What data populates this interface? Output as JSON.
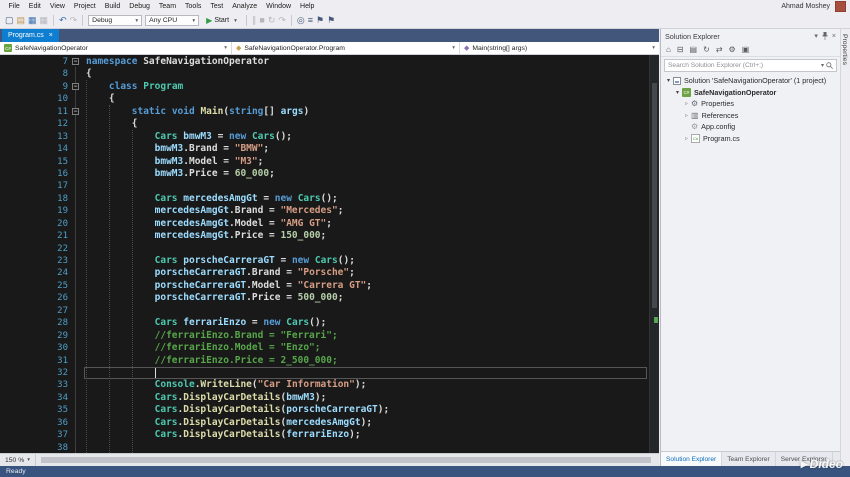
{
  "window": {
    "user": "Ahmad Moshey"
  },
  "menu": {
    "items": [
      "File",
      "Edit",
      "View",
      "Project",
      "Build",
      "Debug",
      "Team",
      "Tools",
      "Test",
      "Analyze",
      "Window",
      "Help"
    ]
  },
  "toolbar": {
    "entries": [
      {
        "type": "icon",
        "name": "new-project-icon",
        "glyph": "▢",
        "cls": "navy"
      },
      {
        "type": "icon",
        "name": "open-file-icon",
        "glyph": "▤",
        "cls": "gold"
      },
      {
        "type": "icon",
        "name": "save-icon",
        "glyph": "▦",
        "cls": "blue"
      },
      {
        "type": "icon",
        "name": "save-all-icon",
        "glyph": "▦",
        "cls": "dim"
      },
      {
        "type": "sep"
      },
      {
        "type": "icon",
        "name": "undo-icon",
        "glyph": "↶",
        "cls": "blue"
      },
      {
        "type": "icon",
        "name": "redo-icon",
        "glyph": "↷",
        "cls": "dim"
      },
      {
        "type": "sep"
      },
      {
        "type": "combo",
        "name": "solution-configurations-dropdown",
        "label": "Debug"
      },
      {
        "type": "combo",
        "name": "solution-platforms-dropdown",
        "label": "Any CPU"
      },
      {
        "type": "start",
        "name": "start-debugging-button",
        "label": "Start"
      },
      {
        "type": "sep"
      },
      {
        "type": "icon",
        "name": "break-all-icon",
        "glyph": "∥",
        "cls": "dim"
      },
      {
        "type": "icon",
        "name": "stop-icon",
        "glyph": "■",
        "cls": "dim"
      },
      {
        "type": "icon",
        "name": "restart-icon",
        "glyph": "↻",
        "cls": "dim"
      },
      {
        "type": "icon",
        "name": "step-over-icon",
        "glyph": "↷",
        "cls": "dim"
      },
      {
        "type": "sep"
      },
      {
        "type": "icon",
        "name": "find-in-files-icon",
        "glyph": "◎",
        "cls": "navy"
      },
      {
        "type": "icon",
        "name": "comment-lines-icon",
        "glyph": "≡",
        "cls": "navy"
      },
      {
        "type": "icon",
        "name": "bookmark-icon",
        "glyph": "⚑",
        "cls": "navy"
      },
      {
        "type": "icon",
        "name": "next-bookmark-icon",
        "glyph": "⚑",
        "cls": "navy"
      }
    ]
  },
  "tabs": [
    {
      "label": "Program.cs",
      "active": true
    }
  ],
  "navbar": {
    "project": "SafeNavigationOperator",
    "type": "SafeNavigationOperator.Program",
    "member": "Main(string[] args)"
  },
  "editor": {
    "zoom_label": "150 %",
    "lines": [
      {
        "n": 7,
        "f": true,
        "t": [
          [
            "kw",
            "namespace"
          ],
          [
            "pl",
            " SafeNavigationOperator"
          ]
        ]
      },
      {
        "n": 8,
        "t": [
          [
            "pl",
            "{"
          ]
        ]
      },
      {
        "n": 9,
        "f": true,
        "t": [
          [
            "pl",
            "    "
          ],
          [
            "kw",
            "class"
          ],
          [
            "pl",
            " "
          ],
          [
            "ty",
            "Program"
          ]
        ]
      },
      {
        "n": 10,
        "t": [
          [
            "pl",
            "    {"
          ]
        ]
      },
      {
        "n": 11,
        "f": true,
        "t": [
          [
            "pl",
            "        "
          ],
          [
            "kw",
            "static"
          ],
          [
            "pl",
            " "
          ],
          [
            "kw",
            "void"
          ],
          [
            "pl",
            " "
          ],
          [
            "m",
            "Main"
          ],
          [
            "pl",
            "("
          ],
          [
            "kw",
            "string"
          ],
          [
            "pl",
            "[] "
          ],
          [
            "va",
            "args"
          ],
          [
            "pl",
            ")"
          ]
        ]
      },
      {
        "n": 12,
        "t": [
          [
            "pl",
            "        {"
          ]
        ]
      },
      {
        "n": 13,
        "t": [
          [
            "pl",
            "            "
          ],
          [
            "ty",
            "Cars"
          ],
          [
            "pl",
            " "
          ],
          [
            "va",
            "bmwM3"
          ],
          [
            "pl",
            " = "
          ],
          [
            "kw",
            "new"
          ],
          [
            "pl",
            " "
          ],
          [
            "ty",
            "Cars"
          ],
          [
            "pl",
            "();"
          ]
        ]
      },
      {
        "n": 14,
        "t": [
          [
            "pl",
            "            "
          ],
          [
            "va",
            "bmwM3"
          ],
          [
            "pl",
            ".Brand = "
          ],
          [
            "st",
            "\"BMW\""
          ],
          [
            "pl",
            ";"
          ]
        ]
      },
      {
        "n": 15,
        "t": [
          [
            "pl",
            "            "
          ],
          [
            "va",
            "bmwM3"
          ],
          [
            "pl",
            ".Model = "
          ],
          [
            "st",
            "\"M3\""
          ],
          [
            "pl",
            ";"
          ]
        ]
      },
      {
        "n": 16,
        "t": [
          [
            "pl",
            "            "
          ],
          [
            "va",
            "bmwM3"
          ],
          [
            "pl",
            ".Price = "
          ],
          [
            "nu",
            "60_000"
          ],
          [
            "pl",
            ";"
          ]
        ]
      },
      {
        "n": 17,
        "t": []
      },
      {
        "n": 18,
        "t": [
          [
            "pl",
            "            "
          ],
          [
            "ty",
            "Cars"
          ],
          [
            "pl",
            " "
          ],
          [
            "va",
            "mercedesAmgGt"
          ],
          [
            "pl",
            " = "
          ],
          [
            "kw",
            "new"
          ],
          [
            "pl",
            " "
          ],
          [
            "ty",
            "Cars"
          ],
          [
            "pl",
            "();"
          ]
        ]
      },
      {
        "n": 19,
        "t": [
          [
            "pl",
            "            "
          ],
          [
            "va",
            "mercedesAmgGt"
          ],
          [
            "pl",
            ".Brand = "
          ],
          [
            "st",
            "\"Mercedes\""
          ],
          [
            "pl",
            ";"
          ]
        ]
      },
      {
        "n": 20,
        "t": [
          [
            "pl",
            "            "
          ],
          [
            "va",
            "mercedesAmgGt"
          ],
          [
            "pl",
            ".Model = "
          ],
          [
            "st",
            "\"AMG GT\""
          ],
          [
            "pl",
            ";"
          ]
        ]
      },
      {
        "n": 21,
        "t": [
          [
            "pl",
            "            "
          ],
          [
            "va",
            "mercedesAmgGt"
          ],
          [
            "pl",
            ".Price = "
          ],
          [
            "nu",
            "150_000"
          ],
          [
            "pl",
            ";"
          ]
        ]
      },
      {
        "n": 22,
        "t": []
      },
      {
        "n": 23,
        "t": [
          [
            "pl",
            "            "
          ],
          [
            "ty",
            "Cars"
          ],
          [
            "pl",
            " "
          ],
          [
            "va",
            "porscheCarreraGT"
          ],
          [
            "pl",
            " = "
          ],
          [
            "kw",
            "new"
          ],
          [
            "pl",
            " "
          ],
          [
            "ty",
            "Cars"
          ],
          [
            "pl",
            "();"
          ]
        ]
      },
      {
        "n": 24,
        "t": [
          [
            "pl",
            "            "
          ],
          [
            "va",
            "porscheCarreraGT"
          ],
          [
            "pl",
            ".Brand = "
          ],
          [
            "st",
            "\"Porsche\""
          ],
          [
            "pl",
            ";"
          ]
        ]
      },
      {
        "n": 25,
        "t": [
          [
            "pl",
            "            "
          ],
          [
            "va",
            "porscheCarreraGT"
          ],
          [
            "pl",
            ".Model = "
          ],
          [
            "st",
            "\"Carrera GT\""
          ],
          [
            "pl",
            ";"
          ]
        ]
      },
      {
        "n": 26,
        "t": [
          [
            "pl",
            "            "
          ],
          [
            "va",
            "porscheCarreraGT"
          ],
          [
            "pl",
            ".Price = "
          ],
          [
            "nu",
            "500_000"
          ],
          [
            "pl",
            ";"
          ]
        ]
      },
      {
        "n": 27,
        "t": []
      },
      {
        "n": 28,
        "t": [
          [
            "pl",
            "            "
          ],
          [
            "ty",
            "Cars"
          ],
          [
            "pl",
            " "
          ],
          [
            "va",
            "ferrariEnzo"
          ],
          [
            "pl",
            " = "
          ],
          [
            "kw",
            "new"
          ],
          [
            "pl",
            " "
          ],
          [
            "ty",
            "Cars"
          ],
          [
            "pl",
            "();"
          ]
        ]
      },
      {
        "n": 29,
        "t": [
          [
            "co",
            "            //ferrariEnzo.Brand = \"Ferrari\";"
          ]
        ]
      },
      {
        "n": 30,
        "t": [
          [
            "co",
            "            //ferrariEnzo.Model = \"Enzo\";"
          ]
        ]
      },
      {
        "n": 31,
        "t": [
          [
            "co",
            "            //ferrariEnzo.Price = 2_500_000;"
          ]
        ]
      },
      {
        "n": 32,
        "c": true,
        "t": []
      },
      {
        "n": 33,
        "t": [
          [
            "pl",
            "            "
          ],
          [
            "ty",
            "Console"
          ],
          [
            "pl",
            "."
          ],
          [
            "m",
            "WriteLine"
          ],
          [
            "pl",
            "("
          ],
          [
            "st",
            "\"Car Information\""
          ],
          [
            "pl",
            ");"
          ]
        ]
      },
      {
        "n": 34,
        "t": [
          [
            "pl",
            "            "
          ],
          [
            "ty",
            "Cars"
          ],
          [
            "pl",
            "."
          ],
          [
            "m",
            "DisplayCarDetails"
          ],
          [
            "pl",
            "("
          ],
          [
            "va",
            "bmwM3"
          ],
          [
            "pl",
            ");"
          ]
        ]
      },
      {
        "n": 35,
        "t": [
          [
            "pl",
            "            "
          ],
          [
            "ty",
            "Cars"
          ],
          [
            "pl",
            "."
          ],
          [
            "m",
            "DisplayCarDetails"
          ],
          [
            "pl",
            "("
          ],
          [
            "va",
            "porscheCarreraGT"
          ],
          [
            "pl",
            ");"
          ]
        ]
      },
      {
        "n": 36,
        "t": [
          [
            "pl",
            "            "
          ],
          [
            "ty",
            "Cars"
          ],
          [
            "pl",
            "."
          ],
          [
            "m",
            "DisplayCarDetails"
          ],
          [
            "pl",
            "("
          ],
          [
            "va",
            "mercedesAmgGt"
          ],
          [
            "pl",
            ");"
          ]
        ]
      },
      {
        "n": 37,
        "t": [
          [
            "pl",
            "            "
          ],
          [
            "ty",
            "Cars"
          ],
          [
            "pl",
            "."
          ],
          [
            "m",
            "DisplayCarDetails"
          ],
          [
            "pl",
            "("
          ],
          [
            "va",
            "ferrariEnzo"
          ],
          [
            "pl",
            ");"
          ]
        ]
      },
      {
        "n": 38,
        "t": []
      }
    ]
  },
  "solution_explorer": {
    "title": "Solution Explorer",
    "search_placeholder": "Search Solution Explorer (Ctrl+;)",
    "toolbar_icons": [
      {
        "name": "home-icon",
        "glyph": "⌂"
      },
      {
        "name": "collapse-all-icon",
        "glyph": "⊟"
      },
      {
        "name": "show-all-files-icon",
        "glyph": "▤"
      },
      {
        "name": "refresh-icon",
        "glyph": "↻"
      },
      {
        "name": "sync-with-active-document-icon",
        "glyph": "⇄"
      },
      {
        "name": "properties-icon",
        "glyph": "⚙"
      },
      {
        "name": "preview-selected-items-icon",
        "glyph": "▣"
      }
    ],
    "tree": [
      {
        "label": "Solution 'SafeNavigationOperator' (1 project)",
        "level": 0,
        "expand": "open",
        "icon": "solution-icon",
        "bold": false
      },
      {
        "label": "SafeNavigationOperator",
        "level": 1,
        "expand": "open",
        "icon": "csharp-project-icon",
        "bold": true
      },
      {
        "label": "Properties",
        "level": 2,
        "expand": "closed",
        "icon": "properties-node-icon",
        "bold": false
      },
      {
        "label": "References",
        "level": 2,
        "expand": "closed",
        "icon": "references-icon",
        "bold": false
      },
      {
        "label": "App.config",
        "level": 2,
        "expand": "none",
        "icon": "config-file-icon",
        "bold": false
      },
      {
        "label": "Program.cs",
        "level": 2,
        "expand": "closed",
        "icon": "csharp-file-icon",
        "bold": false
      }
    ],
    "bottom_tabs": [
      "Solution Explorer",
      "Team Explorer",
      "Server Explorer"
    ]
  },
  "right_strip": {
    "label": "Properties"
  },
  "status": {
    "text": "Ready"
  },
  "watermark": {
    "text": "Dideo"
  },
  "colors": {
    "accent_tab_blue": "#0e7fd0",
    "start_green": "#2f9e44",
    "editor_background": "#191919",
    "keyword_blue": "#569cd6",
    "type_teal": "#4ec9b0",
    "string_orange": "#d69d85",
    "comment_green": "#57a64a",
    "line_number_blue": "#4f9fc8",
    "avatar_red": "#a8503e"
  }
}
